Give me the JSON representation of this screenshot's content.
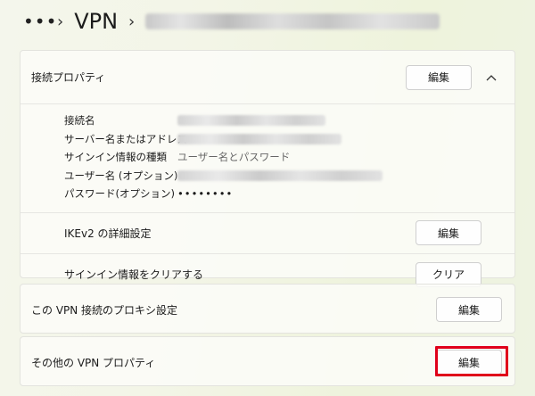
{
  "breadcrumb": {
    "more": "•••",
    "separator": "›",
    "title": "VPN"
  },
  "connection_properties": {
    "header_label": "接続プロパティ",
    "edit_label": "編集",
    "fields": [
      {
        "label": "接続名",
        "value": ""
      },
      {
        "label": "サーバー名またはアドレス",
        "value": ""
      },
      {
        "label": "サインイン情報の種類",
        "value": "ユーザー名とパスワード"
      },
      {
        "label": "ユーザー名 (オプション)",
        "value": ""
      },
      {
        "label": "パスワード(オプション)",
        "value": "••••••••"
      }
    ],
    "ikev2": {
      "label": "IKEv2 の詳細設定",
      "button": "編集"
    },
    "clear_signin": {
      "label": "サインイン情報をクリアする",
      "button": "クリア"
    }
  },
  "proxy_settings": {
    "label": "この VPN 接続のプロキシ設定",
    "button": "編集"
  },
  "other_properties": {
    "label": "その他の VPN プロパティ",
    "button": "編集"
  },
  "colors": {
    "highlight": "#e0001a",
    "background": "#f3f5e7"
  }
}
